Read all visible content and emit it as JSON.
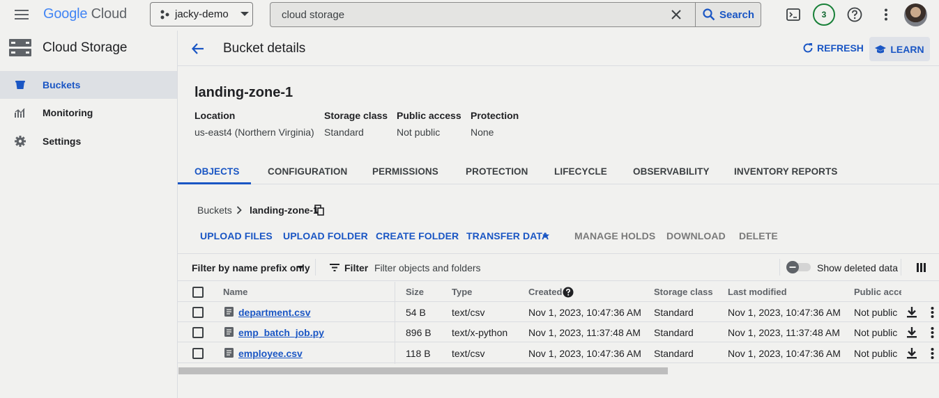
{
  "topbar": {
    "logo_google": "Google",
    "logo_cloud": "Cloud",
    "project": "jacky-demo",
    "search_value": "cloud storage",
    "search_button": "Search",
    "notifications_count": "3"
  },
  "sidebar": {
    "title": "Cloud Storage",
    "items": [
      {
        "label": "Buckets",
        "icon": "bucket-icon",
        "active": true
      },
      {
        "label": "Monitoring",
        "icon": "monitoring-icon",
        "active": false
      },
      {
        "label": "Settings",
        "icon": "gear-icon",
        "active": false
      }
    ]
  },
  "header": {
    "title": "Bucket details",
    "refresh": "REFRESH",
    "learn": "LEARN"
  },
  "bucket": {
    "name": "landing-zone-1",
    "meta": [
      {
        "label": "Location",
        "value": "us-east4 (Northern Virginia)"
      },
      {
        "label": "Storage class",
        "value": "Standard"
      },
      {
        "label": "Public access",
        "value": "Not public"
      },
      {
        "label": "Protection",
        "value": "None"
      }
    ]
  },
  "tabs": [
    "OBJECTS",
    "CONFIGURATION",
    "PERMISSIONS",
    "PROTECTION",
    "LIFECYCLE",
    "OBSERVABILITY",
    "INVENTORY REPORTS"
  ],
  "breadcrumb": {
    "root": "Buckets",
    "current": "landing-zone-1"
  },
  "actions": {
    "upload_files": "UPLOAD FILES",
    "upload_folder": "UPLOAD FOLDER",
    "create_folder": "CREATE FOLDER",
    "transfer_data": "TRANSFER DATA",
    "manage_holds": "MANAGE HOLDS",
    "download": "DOWNLOAD",
    "delete": "DELETE"
  },
  "filter": {
    "mode": "Filter by name prefix only",
    "label": "Filter",
    "placeholder": "Filter objects and folders",
    "show_deleted": "Show deleted data"
  },
  "table": {
    "columns": [
      "Name",
      "Size",
      "Type",
      "Created",
      "Storage class",
      "Last modified",
      "Public acces"
    ],
    "rows": [
      {
        "name": "department.csv",
        "size": "54 B",
        "type": "text/csv",
        "created": "Nov 1, 2023, 10:47:36 AM",
        "storage_class": "Standard",
        "last_modified": "Nov 1, 2023, 10:47:36 AM",
        "public_access": "Not public"
      },
      {
        "name": "emp_batch_job.py",
        "size": "896 B",
        "type": "text/x-python",
        "created": "Nov 1, 2023, 11:37:48 AM",
        "storage_class": "Standard",
        "last_modified": "Nov 1, 2023, 11:37:48 AM",
        "public_access": "Not public"
      },
      {
        "name": "employee.csv",
        "size": "118 B",
        "type": "text/csv",
        "created": "Nov 1, 2023, 10:47:36 AM",
        "storage_class": "Standard",
        "last_modified": "Nov 1, 2023, 10:47:36 AM",
        "public_access": "Not public"
      }
    ]
  },
  "colors": {
    "accent": "#1a56c4",
    "background": "#f1f1ef",
    "badge_green": "#188038"
  }
}
